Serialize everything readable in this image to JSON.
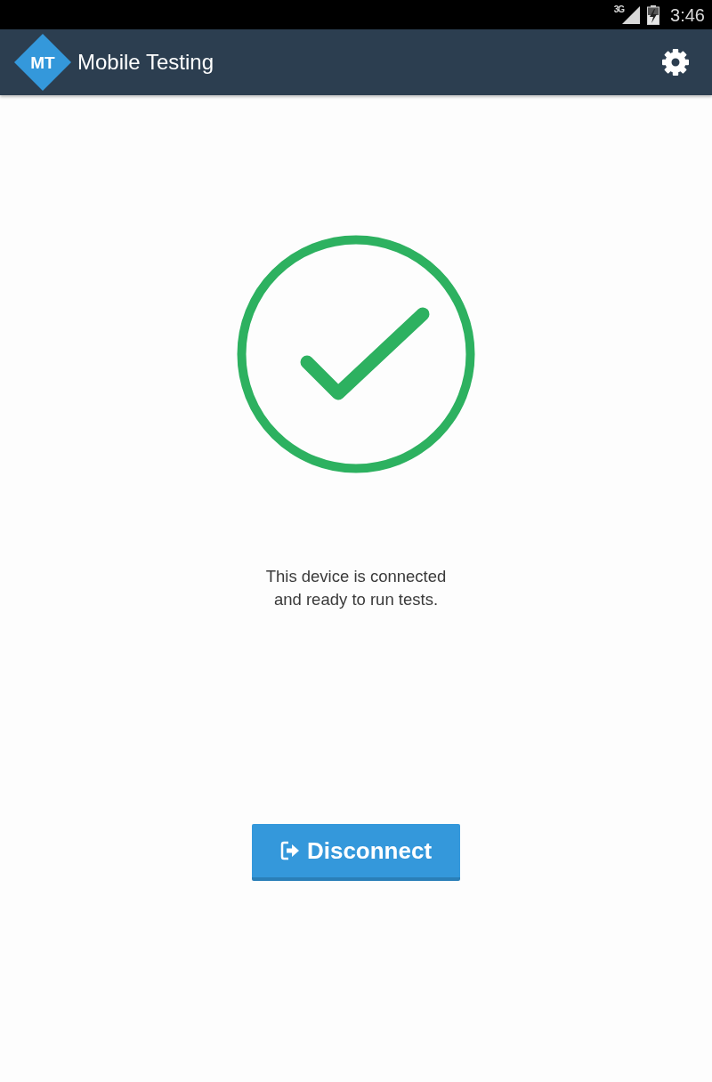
{
  "status_bar": {
    "network": "3G",
    "charging": true,
    "time": "3:46"
  },
  "app_bar": {
    "logo": "MT",
    "title": "Mobile Testing"
  },
  "connection": {
    "connected": true,
    "message": "This device is connected\nand ready to run tests."
  },
  "buttons": [
    {
      "label": "Disconnect"
    }
  ]
}
